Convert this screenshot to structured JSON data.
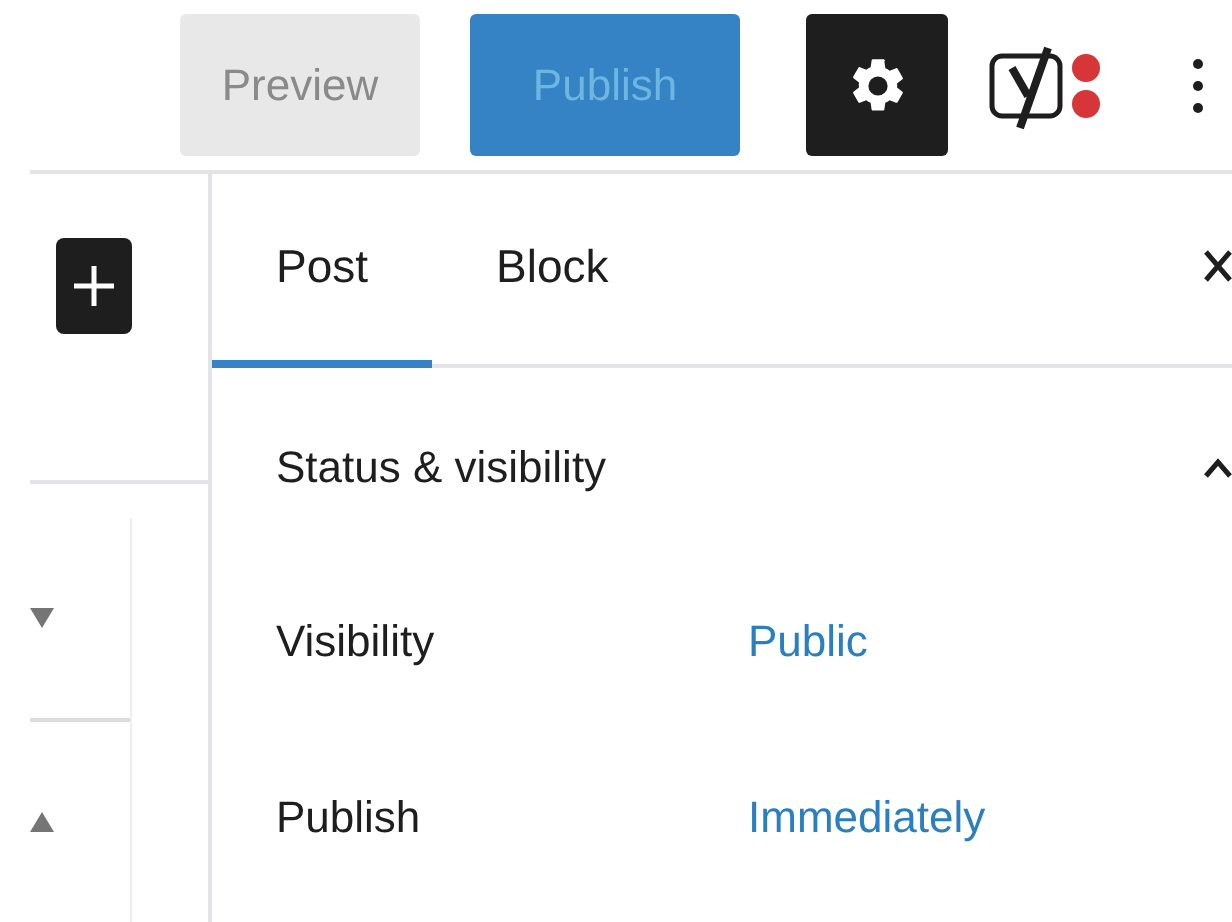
{
  "toolbar": {
    "buttons": [
      {
        "label": "Preview",
        "kind": "secondary",
        "disabled": true
      },
      {
        "label": "Publish",
        "kind": "primary",
        "disabled": true
      }
    ],
    "settings": {
      "pressed": true
    }
  },
  "sidebar": {
    "tabs": [
      {
        "label": "Post",
        "selected": true
      },
      {
        "label": "Block",
        "selected": false
      }
    ],
    "panel": {
      "title": "Status & visibility",
      "expanded": true,
      "rows": [
        {
          "label": "Visibility",
          "value": "Public"
        },
        {
          "label": "Publish",
          "value": "Immediately"
        }
      ]
    }
  }
}
